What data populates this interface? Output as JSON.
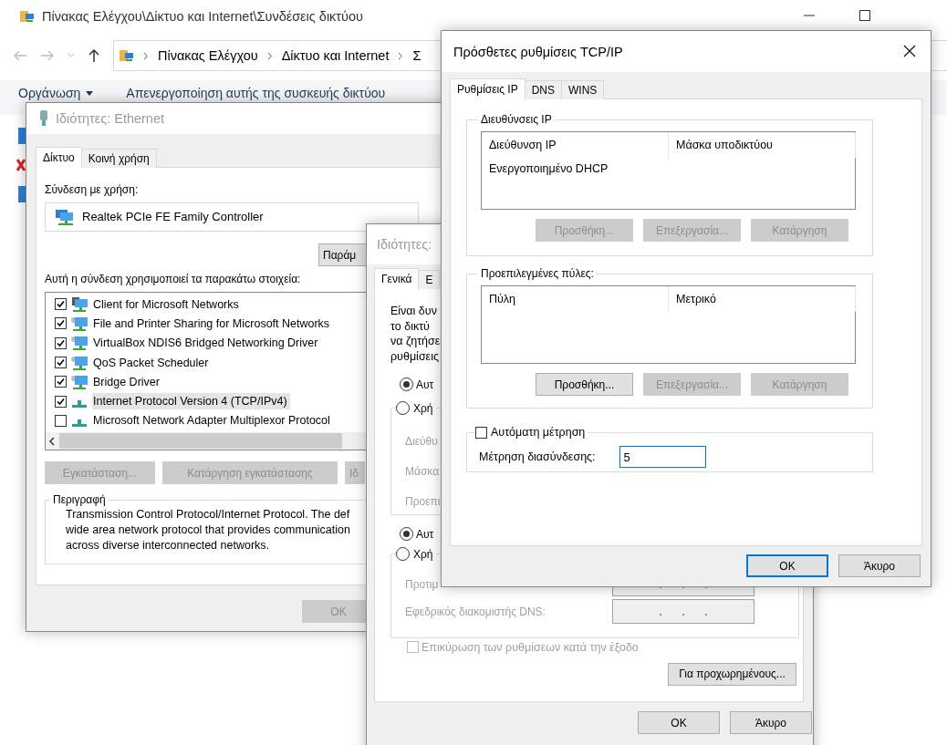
{
  "explorer": {
    "title": "Πίνακας Ελέγχου\\Δίκτυο και Internet\\Συνδέσεις δικτύου",
    "breadcrumb": [
      "Πίνακας Ελέγχου",
      "Δίκτυο και Internet",
      "Σ"
    ],
    "toolbar": [
      {
        "label": "Οργάνωση",
        "dropdown": true
      },
      {
        "label": "Απενεργοποίηση αυτής της συσκευής δικτύου",
        "dropdown": false
      }
    ]
  },
  "ethernet_window": {
    "title": "Ιδιότητες: Ethernet",
    "tabs": [
      {
        "label": "Δίκτυο",
        "selected": true
      },
      {
        "label": "Κοινή χρήση",
        "selected": false
      }
    ],
    "connect_label": "Σύνδεση με χρήση:",
    "adapter": "Realtek PCIe FE Family Controller",
    "configure_button": "Παράμ",
    "items_label": "Αυτή η σύνδεση χρησιμοποιεί τα παρακάτω στοιχεία:",
    "items": [
      {
        "label": "Client for Microsoft Networks",
        "kind": "client",
        "checked": true,
        "selected": false
      },
      {
        "label": "File and Printer Sharing for Microsoft Networks",
        "kind": "service",
        "checked": true,
        "selected": false
      },
      {
        "label": "VirtualBox NDIS6 Bridged Networking Driver",
        "kind": "service",
        "checked": true,
        "selected": false
      },
      {
        "label": "QoS Packet Scheduler",
        "kind": "service",
        "checked": true,
        "selected": false
      },
      {
        "label": "Bridge Driver",
        "kind": "service",
        "checked": true,
        "selected": false
      },
      {
        "label": "Internet Protocol Version 4 (TCP/IPv4)",
        "kind": "protocol",
        "checked": true,
        "selected": true
      },
      {
        "label": "Microsoft Network Adapter Multiplexor Protocol",
        "kind": "protocol",
        "checked": false,
        "selected": false
      }
    ],
    "buttons": [
      {
        "label": "Εγκατάσταση...",
        "disabled": true
      },
      {
        "label": "Κατάργηση εγκατάστασης",
        "disabled": true
      },
      {
        "label": "Ιδ",
        "disabled": true
      }
    ],
    "description": {
      "legend": "Περιγραφή",
      "lines": [
        "Transmission Control Protocol/Internet Protocol. The def",
        "wide area network protocol that provides communication",
        "across diverse interconnected networks."
      ]
    },
    "ok_button": {
      "label": "OK",
      "disabled": true
    }
  },
  "ipv4_window": {
    "title": "Ιδιότητες:",
    "tabs": [
      {
        "label": "Γενικά",
        "selected": true
      },
      {
        "label": "Ε",
        "selected": false
      }
    ],
    "intro_lines": [
      "Είναι δυν",
      "το δικτύ",
      "να ζητήσε",
      "ρυθμίσεις"
    ],
    "ip_options": [
      {
        "label": "Αυτ",
        "selected": true
      },
      {
        "label": "Χρή",
        "selected": false
      }
    ],
    "ip_fields": [
      "Διεύθυ",
      "Μάσκα",
      "Προεπι"
    ],
    "dns_options": [
      {
        "label": "Αυτ",
        "selected": true
      },
      {
        "label": "Χρή",
        "selected": false
      }
    ],
    "dns_fields": [
      {
        "label": "Προτιμ",
        "disabled": true
      },
      {
        "label": "Εφεδρικός διακομιστής DNS:",
        "disabled": true
      }
    ],
    "validate": {
      "label": "Επικύρωση των ρυθμίσεων κατά την έξοδο",
      "checked": false,
      "disabled": true
    },
    "advanced_button": "Για προχωρημένους...",
    "buttons": [
      {
        "label": "OK",
        "default": false
      },
      {
        "label": "Άκυρο",
        "default": false
      }
    ]
  },
  "tcpip_window": {
    "title": "Πρόσθετες ρυθμίσεις TCP/IP",
    "tabs": [
      {
        "label": "Ρυθμίσεις IP",
        "selected": true
      },
      {
        "label": "DNS",
        "selected": false
      },
      {
        "label": "WINS",
        "selected": false
      }
    ],
    "ip_group": {
      "legend": "Διευθύνσεις IP",
      "columns": [
        "Διεύθυνση IP",
        "Μάσκα υποδικτύου"
      ],
      "rows": [
        [
          "Ενεργοποιημένο DHCP"
        ]
      ],
      "buttons": [
        {
          "label": "Προσθήκη...",
          "disabled": true
        },
        {
          "label": "Επεξεργασία...",
          "disabled": true
        },
        {
          "label": "Κατάργηση",
          "disabled": true
        }
      ]
    },
    "gateway_group": {
      "legend": "Προεπιλεγμένες πύλες:",
      "columns": [
        "Πύλη",
        "Μετρικό"
      ],
      "buttons": [
        {
          "label": "Προσθήκη...",
          "disabled": false
        },
        {
          "label": "Επεξεργασία...",
          "disabled": true
        },
        {
          "label": "Κατάργηση",
          "disabled": true
        }
      ]
    },
    "auto_metric": {
      "label": "Αυτόματη μέτρηση",
      "checked": false
    },
    "metric_label": "Μέτρηση διασύνδεσης:",
    "metric_value": "5",
    "buttons": [
      {
        "label": "OK",
        "default": true
      },
      {
        "label": "Άκυρο",
        "default": false
      }
    ]
  }
}
